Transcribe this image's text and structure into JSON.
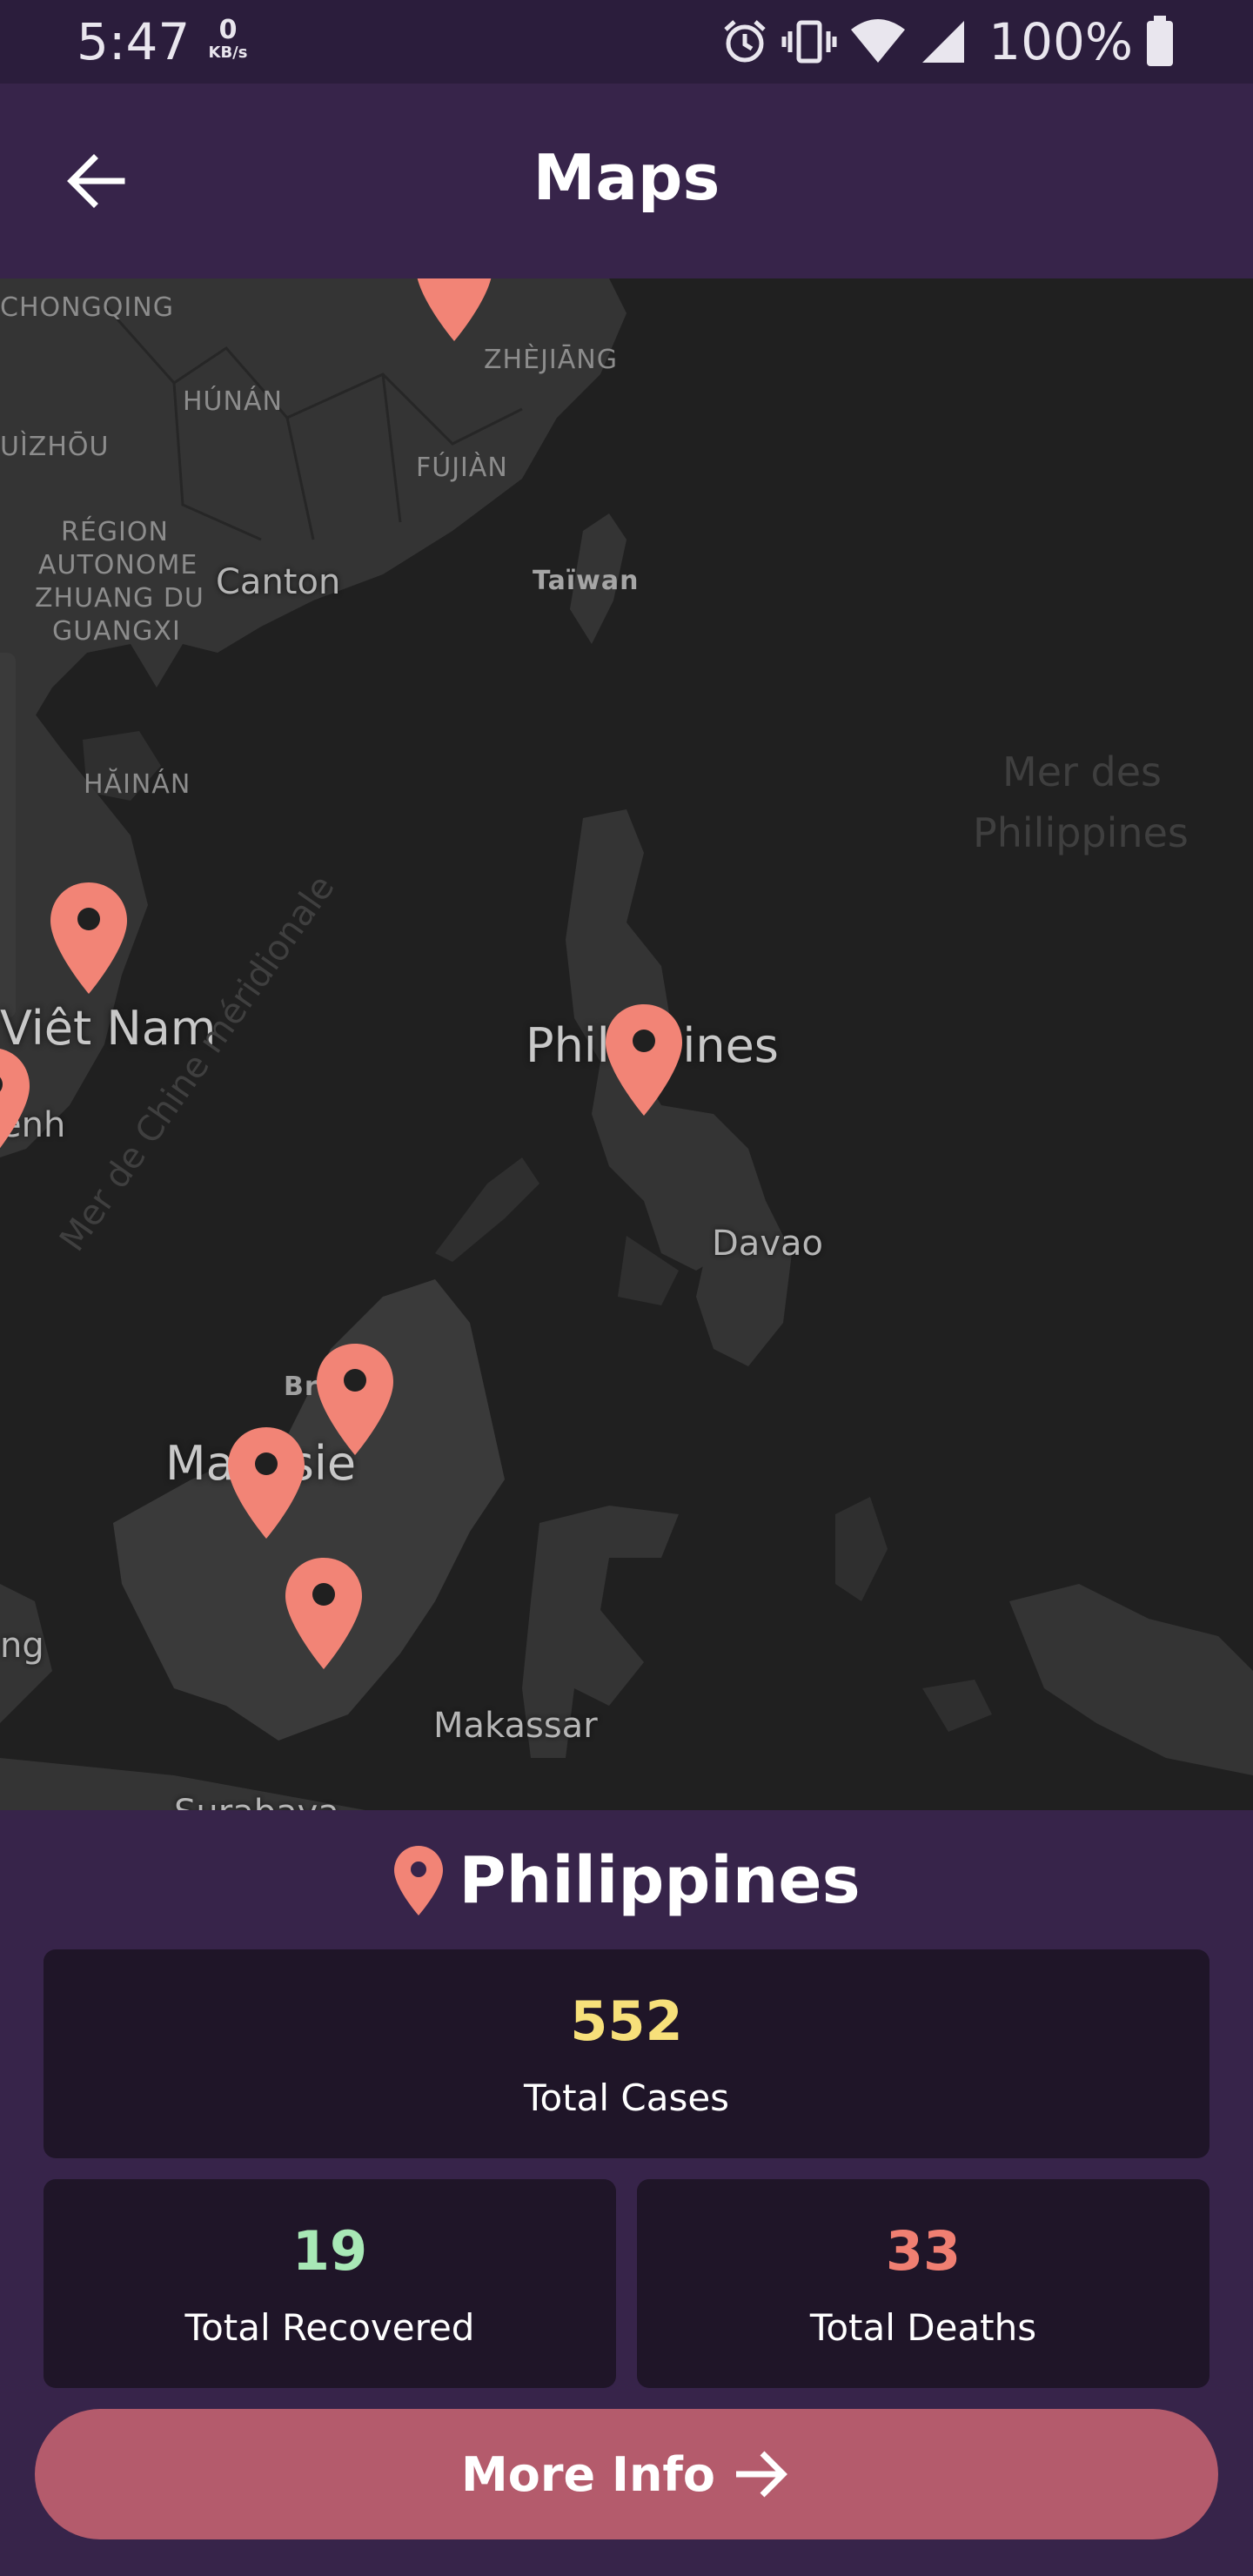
{
  "status_bar": {
    "time": "5:47",
    "net_speed_value": "0",
    "net_speed_unit": "KB/s",
    "battery_text": "100%",
    "icons": [
      "alarm-icon",
      "vibrate-icon",
      "wifi-icon",
      "signal-icon",
      "battery-icon"
    ]
  },
  "header": {
    "title": "Maps",
    "back_icon": "arrow-left-icon"
  },
  "map": {
    "labels": {
      "chongqing": "CHONGQING",
      "zhejiang": "ZHÈJIĀNG",
      "hunan": "HÚNÁN",
      "guizhou": "UÌZHŌU",
      "fujian": "FÚJIÀN",
      "region1": "RÉGION",
      "region2": "AUTONOME",
      "region3": "ZHUANG DU",
      "region4": "GUANGXI",
      "canton": "Canton",
      "taiwan": "Taïwan",
      "hainan": "HĂINÁN",
      "mer_phil_1": "Mer des",
      "mer_phil_2": "Philippines",
      "vietnam": "Viêt Nam",
      "penh": "enh",
      "mer_chine": "Mer de Chine méridionale",
      "philippines": "Philippines",
      "davao": "Davao",
      "brunei": "Brunei",
      "malaisie": "Malaisie",
      "ng": "ng",
      "makassar": "Makassar",
      "surabaya": "Surabaya"
    },
    "marker_color": "#f28476"
  },
  "panel": {
    "country": "Philippines",
    "location_icon": "location-pin-icon",
    "total_cases_value": "552",
    "total_cases_label": "Total Cases",
    "total_recovered_value": "19",
    "total_recovered_label": "Total Recovered",
    "total_deaths_value": "33",
    "total_deaths_label": "Total Deaths",
    "more_info_label": "More Info",
    "colors": {
      "cases": "#f7e07a",
      "recovered": "#a8e8b6",
      "deaths": "#f07f72",
      "button": "#b45b6c"
    }
  }
}
